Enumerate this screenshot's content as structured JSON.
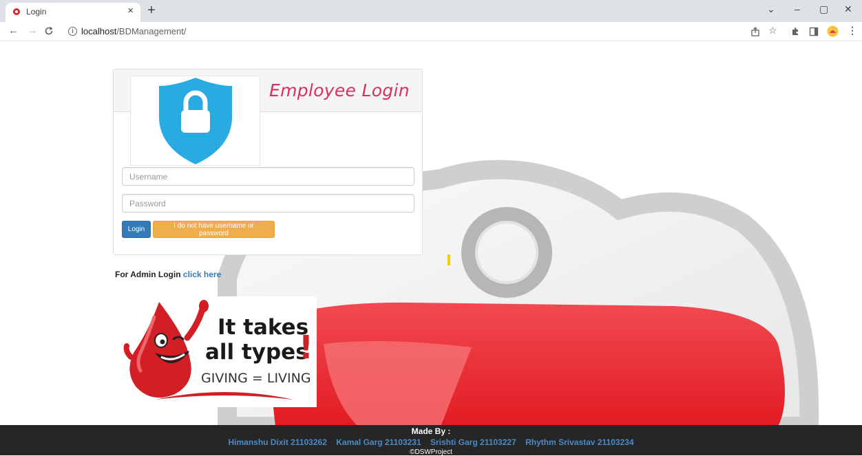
{
  "browser": {
    "tab": {
      "title": "Login",
      "favicon": "blood-drop-favicon-icon",
      "close": "×"
    },
    "new_tab": "+",
    "window_controls": {
      "chevron": "⌄",
      "minimize": "–",
      "restore": "▢",
      "close": "✕"
    },
    "nav": {
      "back": "←",
      "forward": "→",
      "reload": "C"
    },
    "url": {
      "host": "localhost",
      "path": "/BDManagement/"
    },
    "toolbar_icons": [
      "share-icon",
      "star-icon",
      "extensions-icon",
      "sidepanel-icon",
      "profile-avatar-icon",
      "menu-icon"
    ]
  },
  "login": {
    "title": "Employee Login",
    "username_placeholder": "Username",
    "password_placeholder": "Password",
    "login_button": "Login",
    "no_credentials_button": "I do not have username or password"
  },
  "admin": {
    "prefix": "For Admin Login",
    "link_text": "click here"
  },
  "promo": {
    "line1": "It takes",
    "line2": "all types",
    "exclaim": "!",
    "tagline": "GIVING = LIVING"
  },
  "footer": {
    "made_by": "Made By :",
    "members": [
      "Himanshu Dixit 21103262",
      "Kamal Garg 21103231",
      "Srishti Garg 21103227",
      "Rhythm Srivastav 21103234"
    ],
    "copyright": "©DSWProject"
  },
  "colors": {
    "title_accent": "#d8305a",
    "primary_button": "#337ab7",
    "warning_button": "#f0ad4e",
    "shield_blue": "#29abe2",
    "footer_bg": "#262626",
    "footer_names": "#4a8bc8",
    "blood_red": "#e21b23"
  }
}
